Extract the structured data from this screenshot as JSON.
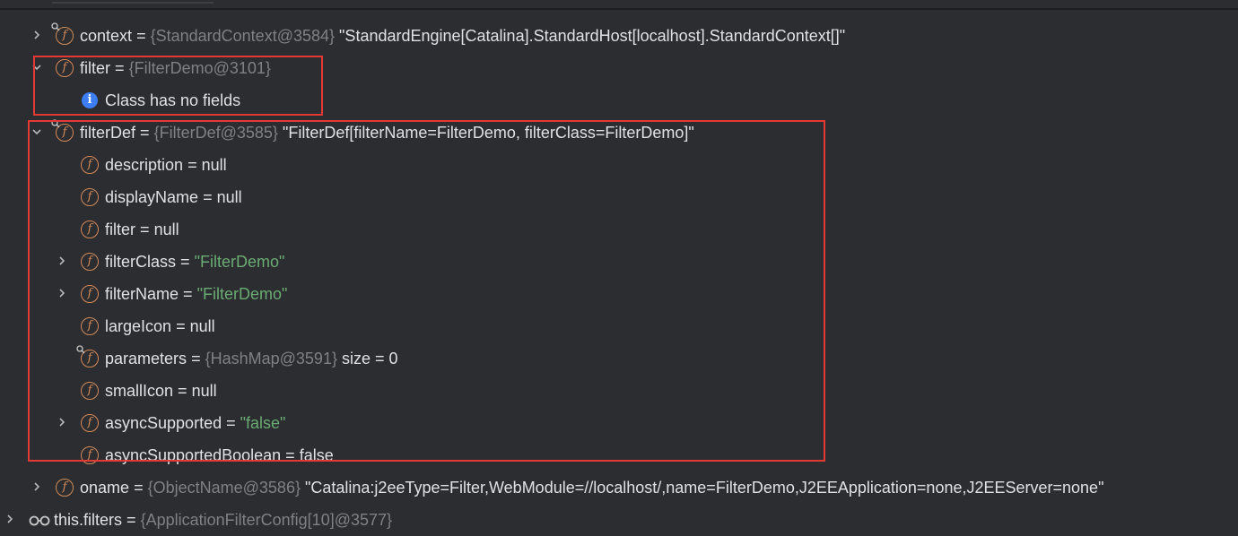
{
  "colors": {
    "background": "#2b2d30",
    "field_icon": "#d58a5a",
    "string": "#6aab73",
    "reference": "#7e8185",
    "highlight": "#e53935",
    "info": "#3d7df5"
  },
  "rows": {
    "context": {
      "name": "context",
      "eq": "=",
      "ref": "{StandardContext@3584}",
      "value": "\"StandardEngine[Catalina].StandardHost[localhost].StandardContext[]\""
    },
    "filter": {
      "name": "filter",
      "eq": "=",
      "ref": "{FilterDemo@3101}"
    },
    "no_fields": {
      "text": "Class has no fields"
    },
    "filterDef": {
      "name": "filterDef",
      "eq": "=",
      "ref": "{FilterDef@3585}",
      "value": "\"FilterDef[filterName=FilterDemo, filterClass=FilterDemo]\""
    },
    "description": {
      "name": "description",
      "eq": "=",
      "value": "null"
    },
    "displayName": {
      "name": "displayName",
      "eq": "=",
      "value": "null"
    },
    "filter_child": {
      "name": "filter",
      "eq": "=",
      "value": "null"
    },
    "filterClass": {
      "name": "filterClass",
      "eq": "=",
      "value": "\"FilterDemo\""
    },
    "filterName": {
      "name": "filterName",
      "eq": "=",
      "value": "\"FilterDemo\""
    },
    "largeIcon": {
      "name": "largeIcon",
      "eq": "=",
      "value": "null"
    },
    "parameters": {
      "name": "parameters",
      "eq": "=",
      "ref": "{HashMap@3591}",
      "value": "size = 0"
    },
    "smallIcon": {
      "name": "smallIcon",
      "eq": "=",
      "value": "null"
    },
    "asyncSupported": {
      "name": "asyncSupported",
      "eq": "=",
      "value": "\"false\""
    },
    "asyncSupportedBoolean": {
      "name": "asyncSupportedBoolean",
      "eq": "=",
      "value": "false"
    },
    "oname": {
      "name": "oname",
      "eq": "=",
      "ref": "{ObjectName@3586}",
      "value": "\"Catalina:j2eeType=Filter,WebModule=//localhost/,name=FilterDemo,J2EEApplication=none,J2EEServer=none\""
    },
    "this_filters": {
      "name": "this.filters",
      "eq": "=",
      "ref": "{ApplicationFilterConfig[10]@3577}"
    }
  },
  "icons": {
    "field": "f",
    "info": "i"
  }
}
